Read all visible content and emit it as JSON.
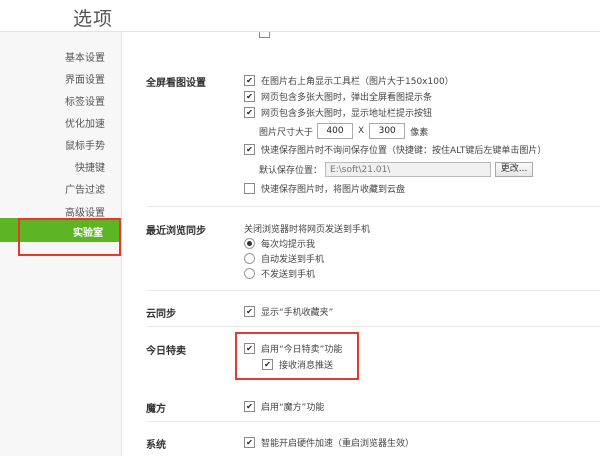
{
  "window": {
    "title": "选项"
  },
  "sidebar": {
    "items": [
      {
        "label": "基本设置"
      },
      {
        "label": "界面设置"
      },
      {
        "label": "标签设置"
      },
      {
        "label": "优化加速"
      },
      {
        "label": "鼠标手势"
      },
      {
        "label": "快捷键"
      },
      {
        "label": "广告过滤"
      },
      {
        "label": "高级设置"
      },
      {
        "label": "实验室",
        "active": true
      }
    ]
  },
  "fullscreen": {
    "label": "全屏看图设置",
    "show_toolbar": {
      "label": "在图片右上角显示工具栏（图片大于150x100）",
      "checked": true
    },
    "popup_prompt": {
      "label": "网页包含多张大图时，弹出全屏看图提示条",
      "checked": true
    },
    "address_button": {
      "label": "网页包含多张大图时，显示地址栏提示按钮",
      "checked": true
    },
    "size": {
      "prefix": "图片尺寸大于",
      "width": "400",
      "x": "X",
      "height": "300",
      "unit": "像素"
    },
    "quick_save": {
      "label": "快速保存图片时不询问保存位置（快捷键：按住ALT键后左键单击图片）",
      "checked": true
    },
    "default_path": {
      "label": "默认保存位置：",
      "value": "E:\\soft\\21.01\\",
      "button": "更改..."
    },
    "cloud_save": {
      "label": "快速保存图片时，将图片收藏到云盘",
      "checked": false
    }
  },
  "sync": {
    "label": "最近浏览同步",
    "desc": "关闭浏览器时将网页发送到手机",
    "options": [
      {
        "label": "每次均提示我",
        "selected": true
      },
      {
        "label": "自动发送到手机",
        "selected": false
      },
      {
        "label": "不发送到手机",
        "selected": false
      }
    ]
  },
  "cloud": {
    "label": "云同步",
    "show_mobile": {
      "label": "显示“手机收藏夹”",
      "checked": true
    }
  },
  "deals": {
    "label": "今日特卖",
    "enable": {
      "label": "启用“今日特卖”功能",
      "checked": true
    },
    "push": {
      "label": "接收消息推送",
      "checked": true
    }
  },
  "magic": {
    "label": "魔方",
    "enable": {
      "label": "启用“魔方”功能",
      "checked": true
    }
  },
  "system": {
    "label": "系统",
    "gpu": {
      "label": "智能开启硬件加速（重启浏览器生效）",
      "checked": true
    }
  },
  "colors": {
    "accent": "#5cb523",
    "highlight": "#e8382c"
  }
}
